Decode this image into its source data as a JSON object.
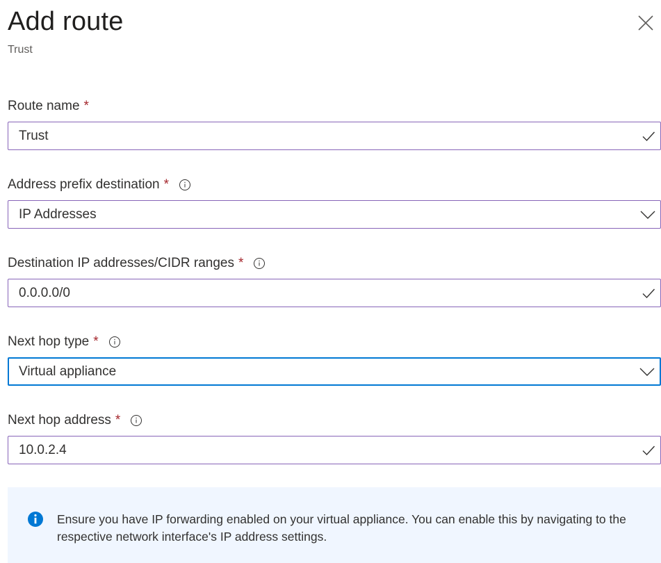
{
  "header": {
    "title": "Add route",
    "subtitle": "Trust"
  },
  "colors": {
    "required": "#a4262c",
    "valid_border": "#8764b8",
    "focus_border": "#0078d4",
    "banner_bg": "#f0f6ff"
  },
  "fields": {
    "route_name": {
      "label": "Route name",
      "required": "*",
      "value": "Trust",
      "state": "valid",
      "icon": "checkmark-icon"
    },
    "address_prefix": {
      "label": "Address prefix destination",
      "required": "*",
      "value": "IP Addresses",
      "icon": "chevron-down-icon"
    },
    "destination_ip": {
      "label": "Destination IP addresses/CIDR ranges",
      "required": "*",
      "value": "0.0.0.0/0",
      "state": "valid",
      "icon": "checkmark-icon"
    },
    "next_hop_type": {
      "label": "Next hop type",
      "required": "*",
      "value": "Virtual appliance",
      "state": "focused",
      "icon": "chevron-down-icon"
    },
    "next_hop_address": {
      "label": "Next hop address",
      "required": "*",
      "value": "10.0.2.4",
      "state": "valid",
      "icon": "checkmark-icon"
    }
  },
  "info_banner": {
    "icon": "info-filled-icon",
    "text": "Ensure you have IP forwarding enabled on your virtual appliance. You can enable this by navigating to the respective network interface's IP address settings."
  }
}
